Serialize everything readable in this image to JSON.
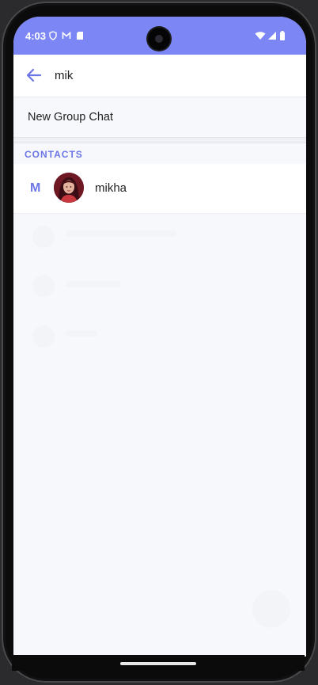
{
  "status_bar": {
    "time": "4:03",
    "left_icons": [
      "shield-icon",
      "gmail-icon",
      "sd-card-icon"
    ],
    "right_icons": [
      "wifi-icon",
      "signal-icon",
      "battery-icon"
    ],
    "color": "#7c86f4"
  },
  "search": {
    "value": "mik",
    "back_icon": "arrow-left-icon"
  },
  "actions": {
    "new_group_label": "New Group Chat"
  },
  "contacts": {
    "section_title": "CONTACTS",
    "accent_color": "#6c76e6",
    "items": [
      {
        "letter": "M",
        "name": "mikha",
        "avatar": "profile-photo"
      }
    ]
  }
}
